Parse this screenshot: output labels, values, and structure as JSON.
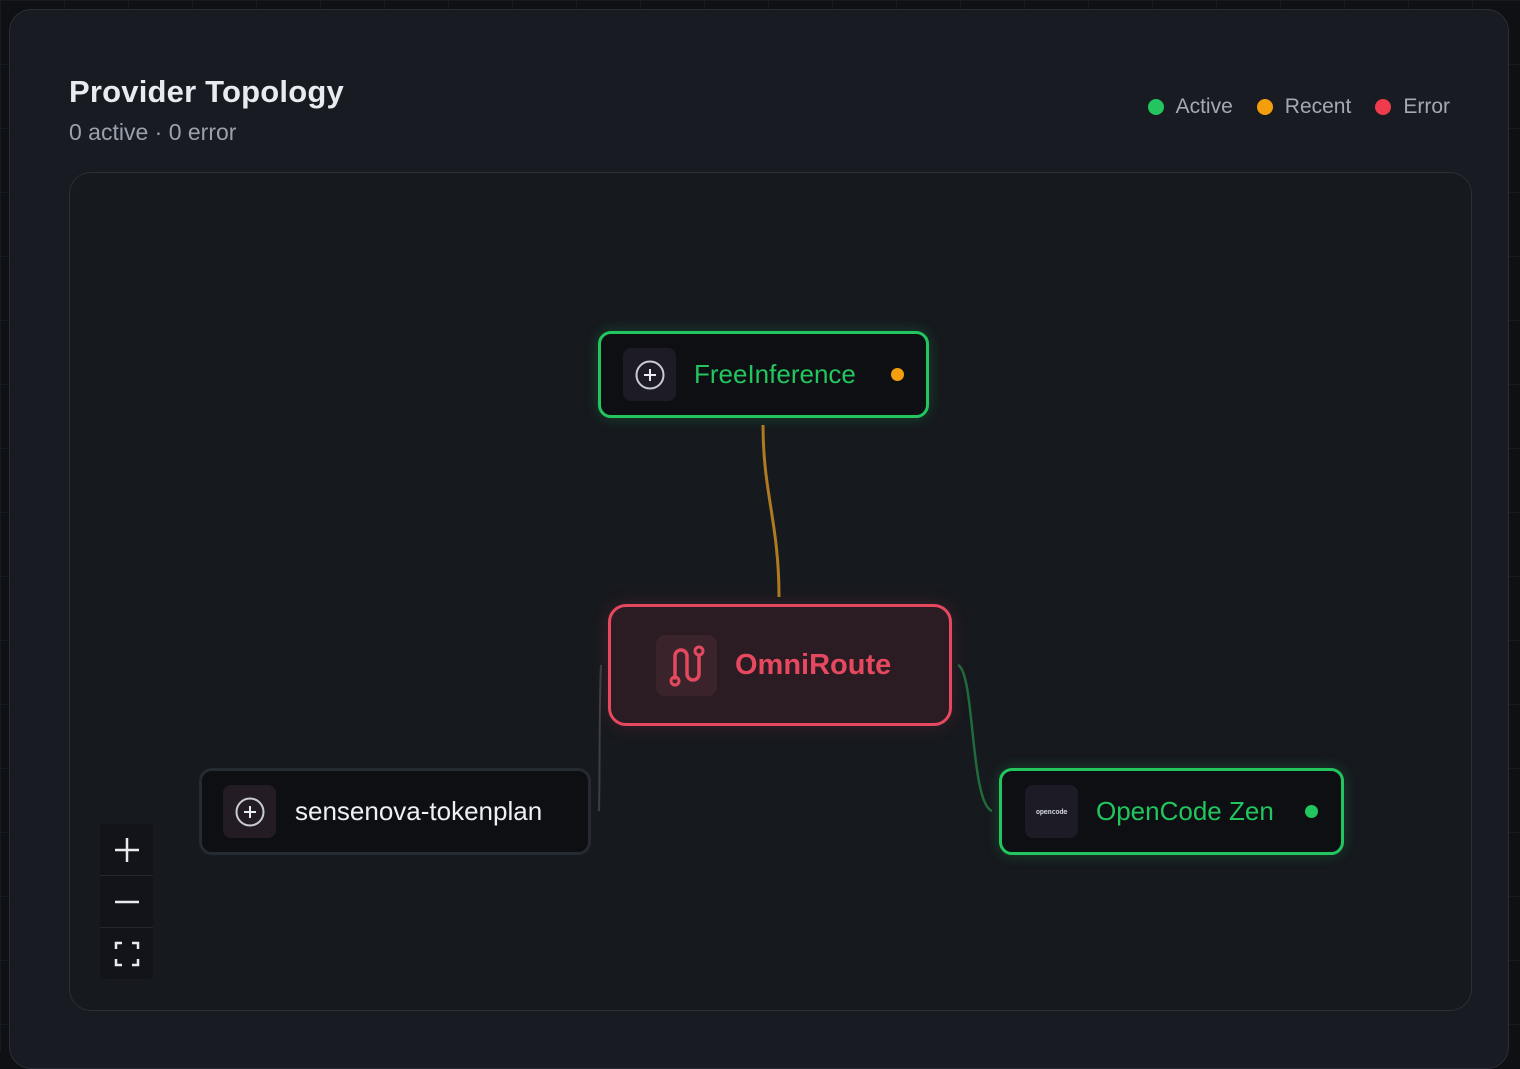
{
  "header": {
    "title": "Provider Topology",
    "subtitle": "0 active · 0 error"
  },
  "legend": [
    {
      "label": "Active",
      "color": "#22c55e"
    },
    {
      "label": "Recent",
      "color": "#f59e0b"
    },
    {
      "label": "Error",
      "color": "#ef3b4e"
    }
  ],
  "nodes": {
    "free_inference": {
      "label": "FreeInference",
      "icon": "plus-circle-icon",
      "status": "recent",
      "status_color": "#f59e0b",
      "color": "#22c55e"
    },
    "omniroute": {
      "label": "OmniRoute",
      "icon": "route-icon",
      "color": "#e5485f"
    },
    "sensenova": {
      "label": "sensenova-tokenplan",
      "icon": "plus-circle-icon",
      "color": "#e8ebf0"
    },
    "opencode": {
      "label": "OpenCode Zen",
      "icon": "opencode-logo",
      "logo_text": "opencode",
      "status": "active",
      "status_color": "#22c55e",
      "color": "#22c55e"
    }
  },
  "controls": {
    "zoom_in": "zoom-in-icon",
    "zoom_out": "zoom-out-icon",
    "fit_view": "fit-view-icon"
  }
}
